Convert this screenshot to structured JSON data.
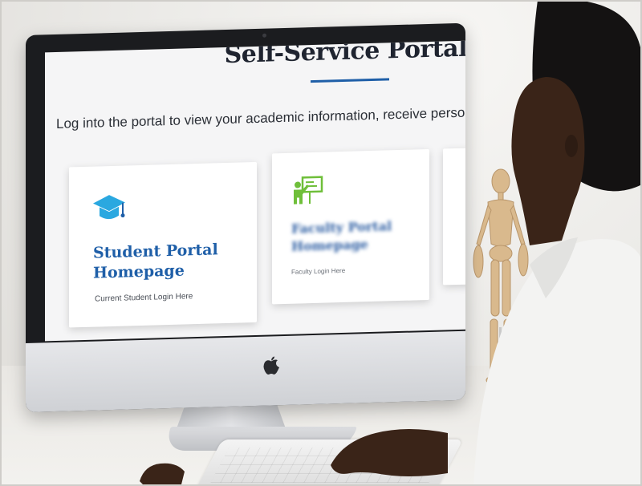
{
  "portal": {
    "title": "Self-Service Portal",
    "intro": "Log into the portal to view your academic information, receive personalized communi"
  },
  "cards": [
    {
      "title": "Student Portal Homepage",
      "subtitle": "Current Student Login Here",
      "icon": "graduation-cap-icon"
    },
    {
      "title": "Faculty Portal Homepage",
      "subtitle": "Faculty Login Here",
      "icon": "teacher-board-icon"
    }
  ],
  "colors": {
    "accent": "#1f5fa8",
    "student_icon": "#2aa8e0",
    "faculty_icon": "#6fbf3a"
  }
}
